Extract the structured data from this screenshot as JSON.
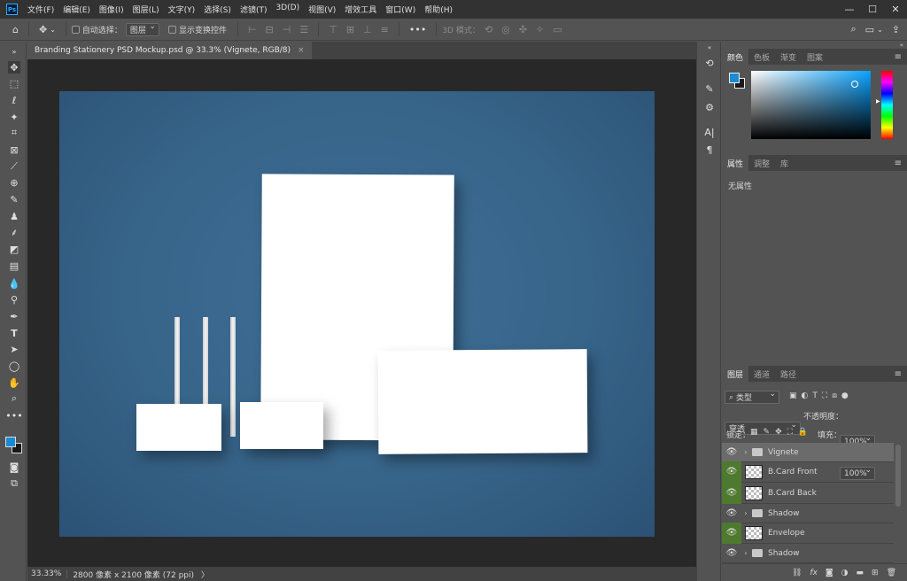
{
  "app": {
    "logo": "Ps"
  },
  "menu": [
    "文件(F)",
    "编辑(E)",
    "图像(I)",
    "图层(L)",
    "文字(Y)",
    "选择(S)",
    "滤镜(T)",
    "3D(D)",
    "视图(V)",
    "增效工具",
    "窗口(W)",
    "帮助(H)"
  ],
  "window_controls": {
    "minimize": "—",
    "maximize": "☐",
    "close": "✕"
  },
  "options": {
    "auto_select_label": "自动选择：",
    "auto_select_value": "图层",
    "show_transform_label": "显示变换控件",
    "more": "•••",
    "mode_3d_label": "3D 模式："
  },
  "document": {
    "tab_title": "Branding Stationery PSD Mockup.psd @ 33.3% (Vignete, RGB/8)",
    "tab_close": "×"
  },
  "status": {
    "zoom": "33.33%",
    "info": "2800 像素 x 2100 像素 (72 ppi)",
    "arrow": "〉"
  },
  "panels": {
    "color_tabs": [
      "颜色",
      "色板",
      "渐变",
      "图案"
    ],
    "properties_tabs": [
      "属性",
      "调整",
      "库"
    ],
    "properties_empty": "无属性",
    "layers_tabs": [
      "图层",
      "通道",
      "路径"
    ]
  },
  "layers_panel": {
    "kind_filter": "类型",
    "blend_mode": "穿透",
    "opacity_label": "不透明度：",
    "opacity_value": "100%",
    "lock_label": "锁定：",
    "fill_label": "填充：",
    "fill_value": "100%",
    "layers": [
      {
        "name": "Vignete",
        "type": "group",
        "visible": true
      },
      {
        "name": "B.Card Front",
        "type": "smart",
        "visible": true
      },
      {
        "name": "B.Card Back",
        "type": "smart",
        "visible": true
      },
      {
        "name": "Shadow",
        "type": "group",
        "visible": true
      },
      {
        "name": "Envelope",
        "type": "smart",
        "visible": true
      },
      {
        "name": "Shadow",
        "type": "group",
        "visible": true
      }
    ]
  },
  "colors": {
    "foreground": "#1a8ad4",
    "background": "#1a1a1a",
    "canvas_bg": "#3a6a91",
    "active_layer": "#6b6b6b",
    "smart_eye": "#4d7a2e"
  },
  "icons": [
    "home-icon",
    "move-icon",
    "marquee-icon",
    "lasso-icon",
    "magic-wand-icon",
    "crop-icon",
    "frame-icon",
    "eyedropper-icon",
    "healing-icon",
    "brush-icon",
    "stamp-icon",
    "history-brush-icon",
    "eraser-icon",
    "gradient-icon",
    "blur-icon",
    "dodge-icon",
    "pen-icon",
    "type-icon",
    "path-select-icon",
    "ellipse-icon",
    "hand-icon",
    "zoom-icon",
    "search-icon",
    "share-icon"
  ]
}
